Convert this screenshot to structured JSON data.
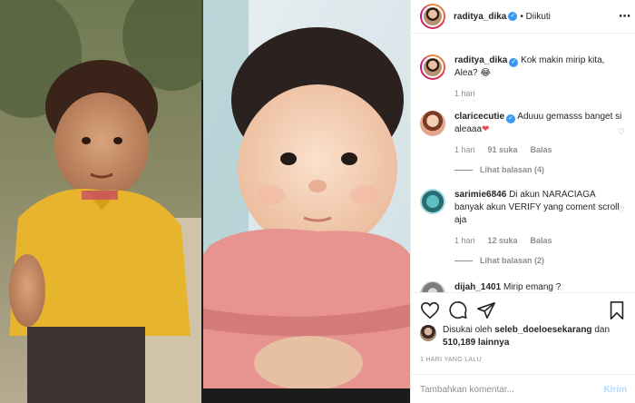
{
  "post": {
    "author": "raditya_dika",
    "follow_state": "• Diikuti",
    "more_icon": "⋯"
  },
  "caption": {
    "username": "raditya_dika",
    "text": "Kok makin mirip kita, Alea?",
    "emoji": "😂",
    "time": "1 hari"
  },
  "comments": [
    {
      "username": "claricecutie",
      "verified": true,
      "text": "Aduuu gemasss banget si aleaaa",
      "emoji": "❤",
      "time": "1 hari",
      "likes": "91 suka",
      "reply_label": "Balas",
      "view_replies": "Lihat balasan (4)"
    },
    {
      "username": "sarimie6846",
      "verified": false,
      "text": "Di akun NARACIAGA banyak akun VERIFY yang coment scroll aja",
      "time": "1 hari",
      "likes": "12 suka",
      "reply_label": "Balas",
      "view_replies": "Lihat balasan (2)"
    },
    {
      "username": "dijah_1401",
      "verified": false,
      "text": "Mirip emang ?"
    }
  ],
  "footer": {
    "liked_by_prefix": "Disukai oleh",
    "liked_by_user": "seleb_doeloesekarang",
    "liked_by_conj": "dan",
    "liked_by_count": "510,189 lainnya",
    "date": "1 HARI YANG LALU",
    "comment_placeholder": "Tambahkan komentar...",
    "post_label": "Kirim"
  },
  "icons": {
    "like": "heart-icon",
    "comment": "comment-icon",
    "share": "share-icon",
    "save": "bookmark-icon",
    "verified": "verified-badge-icon"
  },
  "colors": {
    "verified": "#3897f0",
    "muted": "#8e8e8e",
    "text": "#262626",
    "post_disabled": "#b3dbff",
    "heart_red": "#ed4956"
  }
}
